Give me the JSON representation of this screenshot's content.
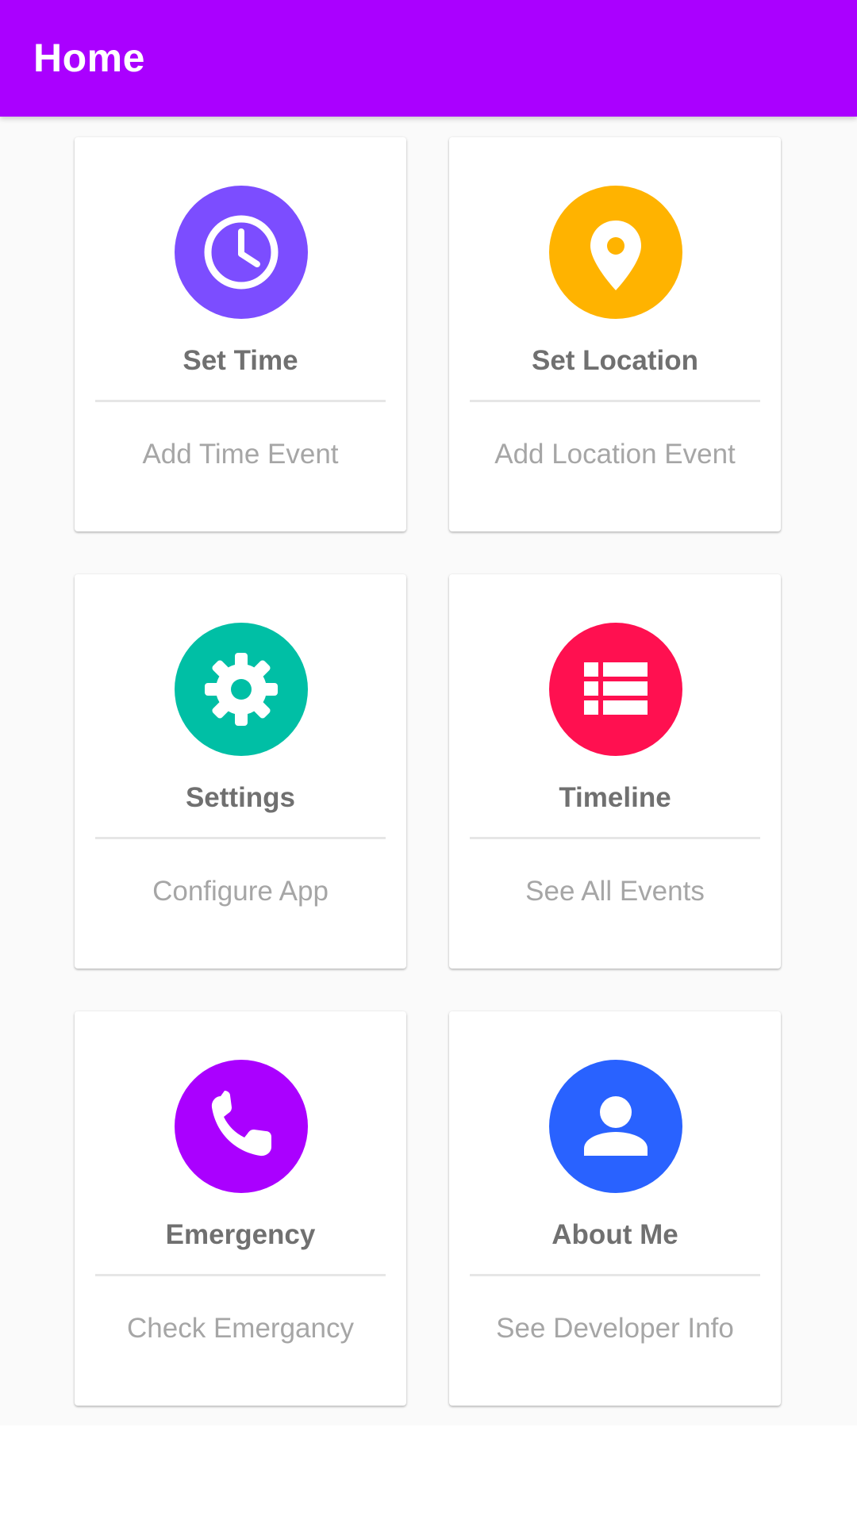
{
  "app_bar": {
    "title": "Home",
    "background_color": "#AA00FF"
  },
  "cards": [
    {
      "title": "Set Time",
      "subtitle": "Add Time Event",
      "icon": "clock-icon",
      "icon_color": "#7C4DFF"
    },
    {
      "title": "Set Location",
      "subtitle": "Add Location Event",
      "icon": "location-pin-icon",
      "icon_color": "#FFB300"
    },
    {
      "title": "Settings",
      "subtitle": "Configure App",
      "icon": "gear-icon",
      "icon_color": "#00BFA5"
    },
    {
      "title": "Timeline",
      "subtitle": "See All Events",
      "icon": "list-icon",
      "icon_color": "#FF1050"
    },
    {
      "title": "Emergency",
      "subtitle": "Check Emergancy",
      "icon": "phone-icon",
      "icon_color": "#AA00FF"
    },
    {
      "title": "About Me",
      "subtitle": "See Developer Info",
      "icon": "person-icon",
      "icon_color": "#2962FF"
    }
  ]
}
